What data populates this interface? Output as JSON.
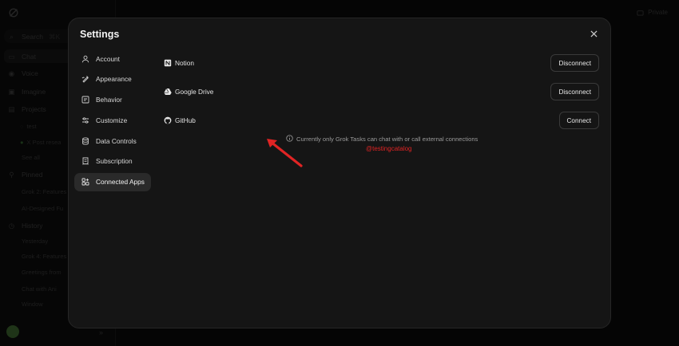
{
  "background": {
    "sidebar": {
      "search": "Search",
      "search_shortcut": "⌘K",
      "items": [
        {
          "label": "Chat",
          "icon": "chat-icon"
        },
        {
          "label": "Voice",
          "icon": "voice-icon"
        },
        {
          "label": "Imagine",
          "icon": "image-icon"
        },
        {
          "label": "Projects",
          "icon": "folder-icon"
        }
      ],
      "projects": [
        "test",
        "X Post resea"
      ],
      "see_all": "See all",
      "pinned_label": "Pinned",
      "pinned": [
        "Grok 2: Features",
        "AI-Designed Fu"
      ],
      "history_label": "History",
      "history_group": "Yesterday",
      "history": [
        "Grok 4: Features",
        "Greetings from",
        "Chat with Ani",
        "Window"
      ]
    },
    "private_label": "Private"
  },
  "modal": {
    "title": "Settings",
    "nav": [
      {
        "label": "Account",
        "icon": "user-icon"
      },
      {
        "label": "Appearance",
        "icon": "palette-icon"
      },
      {
        "label": "Behavior",
        "icon": "behavior-icon"
      },
      {
        "label": "Customize",
        "icon": "sliders-icon"
      },
      {
        "label": "Data Controls",
        "icon": "database-icon"
      },
      {
        "label": "Subscription",
        "icon": "receipt-icon"
      },
      {
        "label": "Connected Apps",
        "icon": "apps-icon",
        "active": true
      }
    ],
    "apps": [
      {
        "name": "Notion",
        "icon": "notion-icon",
        "action": "Disconnect"
      },
      {
        "name": "Google Drive",
        "icon": "google-drive-icon",
        "action": "Disconnect"
      },
      {
        "name": "GitHub",
        "icon": "github-icon",
        "action": "Connect"
      }
    ],
    "info": "Currently only Grok Tasks can chat with or call external connections",
    "watermark": "@testingcatalog"
  },
  "colors": {
    "accent_arrow": "#e02424",
    "watermark": "#e02424"
  }
}
